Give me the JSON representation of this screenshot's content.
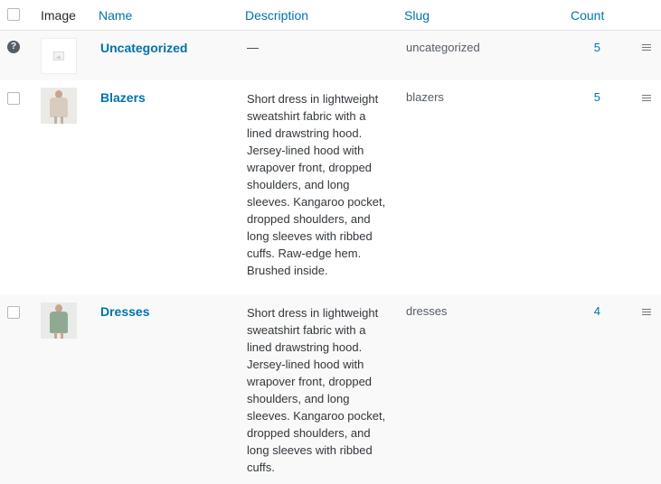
{
  "table": {
    "columns": {
      "image": "Image",
      "name": "Name",
      "description": "Description",
      "slug": "Slug",
      "count": "Count"
    },
    "rows": [
      {
        "name": "Uncategorized",
        "description": "—",
        "slug": "uncategorized",
        "count": "5",
        "image": "placeholder-image-icon",
        "has_help_icon": true
      },
      {
        "name": "Blazers",
        "description": "Short dress in lightweight sweatshirt fabric with a lined drawstring hood. Jersey-lined hood with wrapover front, dropped shoulders, and long sleeves. Kangaroo pocket, dropped shoulders, and long sleeves with ribbed cuffs. Raw-edge hem. Brushed inside.",
        "slug": "blazers",
        "count": "5",
        "image": "blazer-thumbnail"
      },
      {
        "name": "Dresses",
        "description": "Short dress in lightweight sweatshirt fabric with a lined drawstring hood. Jersey-lined hood with wrapover front, dropped shoulders, and long sleeves. Kangaroo pocket, dropped shoulders, and long sleeves with ribbed cuffs.",
        "slug": "dresses",
        "count": "4",
        "image": "dress-thumbnail"
      }
    ]
  },
  "colors": {
    "link": "#0073aa",
    "alt_row": "#f9f9f9",
    "text": "#32373c"
  }
}
